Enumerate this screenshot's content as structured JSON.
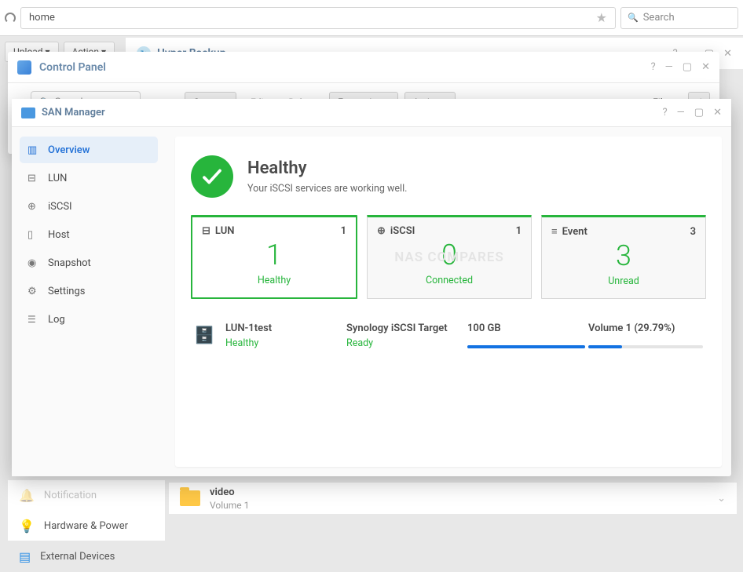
{
  "topbar": {
    "address": "home",
    "search_placeholder": "Search"
  },
  "filebar": {
    "upload": "Upload",
    "action": "Action"
  },
  "hyper_backup": {
    "title": "Hyper Backup"
  },
  "control_panel": {
    "title": "Control Panel",
    "search_placeholder": "Search",
    "toolbar": {
      "create": "Create",
      "edit": "Edit",
      "delete": "Delete",
      "encryption": "Encryption",
      "action": "Action",
      "filter": "Filter"
    },
    "sidebar_peek": {
      "notification": "Notification",
      "hardware_power": "Hardware & Power",
      "external_devices": "External Devices"
    }
  },
  "file_peek": {
    "name": "video",
    "sub": "Volume 1"
  },
  "san": {
    "title": "SAN Manager",
    "sidebar": [
      {
        "key": "overview",
        "label": "Overview",
        "icon": "ic-overview"
      },
      {
        "key": "lun",
        "label": "LUN",
        "icon": "ic-lun"
      },
      {
        "key": "iscsi",
        "label": "iSCSI",
        "icon": "ic-globe"
      },
      {
        "key": "host",
        "label": "Host",
        "icon": "ic-host"
      },
      {
        "key": "snapshot",
        "label": "Snapshot",
        "icon": "ic-camera"
      },
      {
        "key": "settings",
        "label": "Settings",
        "icon": "ic-gear"
      },
      {
        "key": "log",
        "label": "Log",
        "icon": "ic-log"
      }
    ],
    "status": {
      "heading": "Healthy",
      "subtitle": "Your iSCSI services are working well."
    },
    "watermark": "NAS COMPARES",
    "cards": {
      "lun": {
        "label": "LUN",
        "badge": "1",
        "big": "1",
        "sub": "Healthy"
      },
      "iscsi": {
        "label": "iSCSI",
        "badge": "1",
        "big": "0",
        "sub": "Connected"
      },
      "event": {
        "label": "Event",
        "badge": "3",
        "big": "3",
        "sub": "Unread"
      }
    },
    "lun_row": {
      "name": "LUN-1test",
      "name_sub": "Healthy",
      "target": "Synology iSCSI Target",
      "target_sub": "Ready",
      "size": "100 GB",
      "size_pct": 100,
      "volume": "Volume 1 (29.79%)",
      "volume_pct": 29.79
    }
  }
}
